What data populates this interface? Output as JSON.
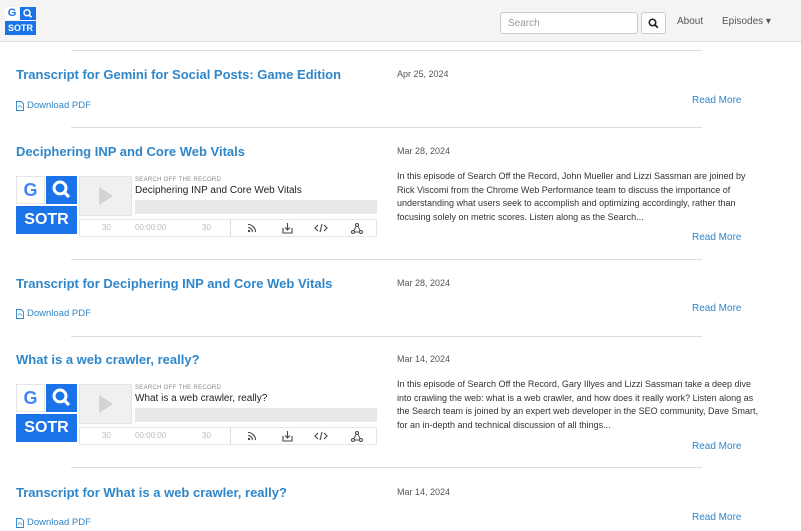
{
  "navbar": {
    "logo_text": "SOTR",
    "logo_letter": "G",
    "search_placeholder": "Search",
    "about_label": "About",
    "episodes_label": "Episodes ▾"
  },
  "episodes": [
    {
      "title": "Transcript for Gemini for Social Posts: Game Edition",
      "date": "Apr 25, 2024",
      "pdf": "Download PDF",
      "read_more": "Read More"
    },
    {
      "title": "Deciphering INP and Core Web Vitals",
      "date": "Mar 28, 2024",
      "description": "In this episode of Search Off the Record, John Mueller and Lizzi Sassman are joined by Rick Viscomi from the Chrome Web Performance team to discuss the importance of understanding what users seek to accomplish and optimizing accordingly, rather than focusing solely on metric scores. Listen along as the Search...",
      "read_more": "Read More",
      "player": {
        "show": "SEARCH OFF THE RECORD",
        "title": "Deciphering INP and Core Web Vitals",
        "speed": "30",
        "time": "00:00:00",
        "skip": "30",
        "art_g": "G",
        "art_s": "SOTR"
      }
    },
    {
      "title": "Transcript for Deciphering INP and Core Web Vitals",
      "date": "Mar 28, 2024",
      "pdf": "Download PDF",
      "read_more": "Read More"
    },
    {
      "title": "What is a web crawler, really?",
      "date": "Mar 14, 2024",
      "description": "In this episode of Search Off the Record, Gary Illyes and Lizzi Sassman take a deep dive into crawling the web: what is a web crawler, and how does it really work? Listen along as the Search team is joined by an expert web developer in the SEO community, Dave Smart, for an in-depth and technical discussion of all things...",
      "read_more": "Read More",
      "player": {
        "show": "SEARCH OFF THE RECORD",
        "title": "What is a web crawler, really?",
        "speed": "30",
        "time": "00:00:00",
        "skip": "30",
        "art_g": "G",
        "art_s": "SOTR"
      }
    },
    {
      "title": "Transcript for What is a web crawler, really?",
      "date": "Mar 14, 2024",
      "pdf": "Download PDF",
      "read_more": "Read More"
    }
  ],
  "colors": {
    "link": "#2f86c9",
    "brand": "#1a73e8"
  }
}
